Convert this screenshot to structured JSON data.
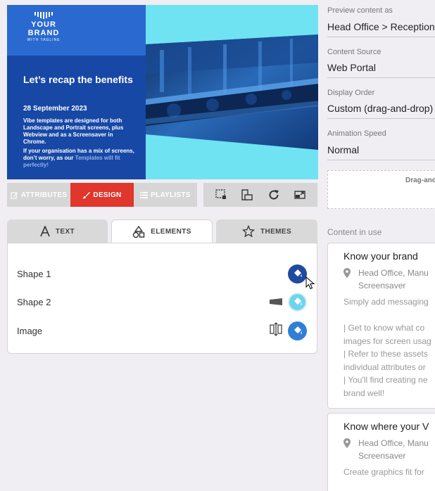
{
  "preview": {
    "brand_name": "YOUR BRAND",
    "brand_tagline": "WITH TAGLINE",
    "headline": "Let’s recap the benefits",
    "date": "28 September 2023",
    "body_1": "Vibe templates are designed for both Landscape and Portrait screens, plus Webview and as a Screensaver in Chrome.",
    "body_2": "If your organisation has a mix of screens, don’t worry, as our",
    "body_3": "Templates will fit perfectly!"
  },
  "toolbar": {
    "attributes_label": "ATTRIBUTES",
    "design_label": "DESIGN",
    "playlists_label": "PLAYLISTS",
    "active": "design"
  },
  "tabs": {
    "text_label": "TEXT",
    "elements_label": "ELEMENTS",
    "themes_label": "THEMES",
    "active": "elements"
  },
  "elements": [
    {
      "label": "Shape 1",
      "color": "#1f4aa0"
    },
    {
      "label": "Shape 2",
      "color": "#6fd4ee"
    },
    {
      "label": "Image",
      "color": "#2f7fd6"
    }
  ],
  "settings": {
    "preview_as_label": "Preview content as",
    "preview_as_value": "Head Office > Reception",
    "content_source_label": "Content Source",
    "content_source_value": "Web Portal",
    "display_order_label": "Display Order",
    "display_order_value": "Custom (drag-and-drop)",
    "animation_speed_label": "Animation Speed",
    "animation_speed_value": "Normal",
    "drop_zone_text": "Drag-and"
  },
  "content_in_use": {
    "title": "Content in use",
    "cards": [
      {
        "title": "Know your brand",
        "location_1": "Head Office, Manu",
        "location_2": "Screensaver",
        "lines": [
          "Simply add messaging",
          "",
          "| Get to know what co",
          "images for screen usag",
          "| Refer to these assets",
          "individual attributes or",
          "| You'll find creating ne",
          "brand well!"
        ]
      },
      {
        "title": "Know where your V",
        "location_1": "Head Office, Manu",
        "location_2": "Screensaver",
        "lines": [
          "Create graphics fit for"
        ]
      }
    ]
  },
  "colors": {
    "accent_red": "#e0362c",
    "brand_blue": "#1f55b8",
    "cyan": "#6fe3f2"
  }
}
